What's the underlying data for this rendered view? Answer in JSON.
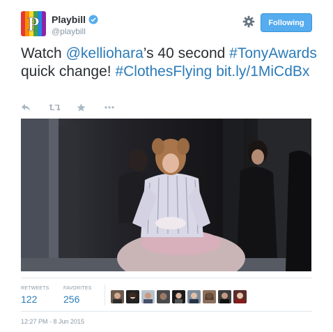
{
  "account": {
    "name": "Playbill",
    "handle": "@playbill",
    "avatar_letter": "P",
    "verified": true
  },
  "follow_button": {
    "label": "Following"
  },
  "tweet": {
    "text_parts": [
      {
        "text": "Watch ",
        "link": false
      },
      {
        "text": "@kelliohara",
        "link": true
      },
      {
        "text": "’s 40 second ",
        "link": false
      },
      {
        "text": "#TonyAwards",
        "link": true
      },
      {
        "text": " quick change! ",
        "link": false
      },
      {
        "text": "#ClothesFlying",
        "link": true
      },
      {
        "text": " ",
        "link": false
      },
      {
        "text": "bit.ly/1MiCdBx",
        "link": true
      }
    ]
  },
  "actions": [
    {
      "name": "reply-icon"
    },
    {
      "name": "retweet-icon"
    },
    {
      "name": "favorite-icon"
    },
    {
      "name": "more-icon"
    }
  ],
  "stats": {
    "retweets_label": "RETWEETS",
    "retweets": "122",
    "favorites_label": "FAVORITES",
    "favorites": "256"
  },
  "timestamp": "12:27 PM - 8 Jun 2015",
  "colors": {
    "link": "#2b7bb9",
    "follow_bg": "#55acee",
    "muted": "#8899a6",
    "text": "#292f33"
  }
}
